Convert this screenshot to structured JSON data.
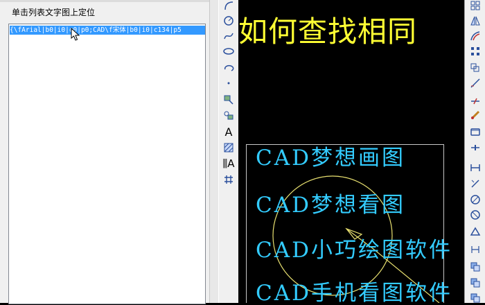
{
  "panel": {
    "label": "单击列表文字图上定位",
    "list_items": [
      "{\\fArial|b0|i0|c0|p0;CAD\\f宋体|b0|i0|c134|p5"
    ]
  },
  "canvas": {
    "headline": "如何查找相同",
    "texts": [
      "CAD梦想画图",
      "CAD梦想看图",
      "CAD小巧绘图软件",
      "CAD手机看图软件"
    ]
  },
  "colors": {
    "headline": "#ffff33",
    "cad_text": "#33ccff",
    "selection": "#3399ff",
    "circle": "#e8e070"
  },
  "toolbar_left": [
    "arc-icon",
    "circle-icon",
    "spline-icon",
    "ellipse-icon",
    "ellipse-arc-icon",
    "point-icon",
    "block-insert-icon",
    "block-make-icon",
    "text-icon",
    "hatch-icon",
    "multiline-text-icon",
    "table-icon"
  ],
  "toolbar_right": [
    "copy-icon",
    "mirror-icon",
    "offset-icon",
    "array-icon",
    "move-icon",
    "rotate-icon",
    "scale-icon",
    "stretch-icon",
    "trim-icon",
    "extend-icon",
    "break-icon",
    "join-icon",
    "chamfer-icon",
    "fillet-icon",
    "explode-icon",
    "linear-dimension-icon",
    "aligned-dimension-icon",
    "arc-dimension-icon",
    "radius-dimension-icon",
    "diameter-dimension-icon",
    "angular-dimension-icon",
    "baseline-dimension-icon",
    "copy-object-icon",
    "paste-icon"
  ]
}
